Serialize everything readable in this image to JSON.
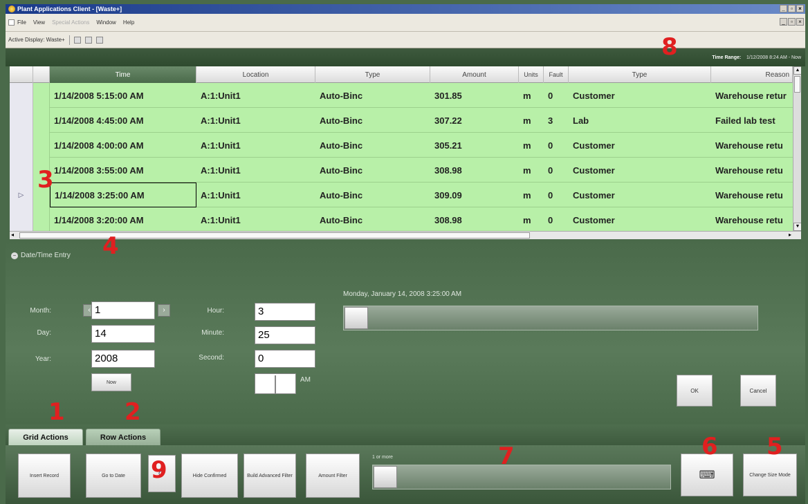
{
  "window": {
    "title": "Plant Applications Client - [Waste+]"
  },
  "menu": {
    "items": [
      "File",
      "View",
      "Special Actions",
      "Window",
      "Help"
    ]
  },
  "toolbar": {
    "active_display": "Active Display: Waste+"
  },
  "header": {
    "time_range_label": "Time Range:",
    "time_range_value": "1/12/2008 8:24 AM - Now"
  },
  "grid": {
    "columns": [
      "Time",
      "Location",
      "Type",
      "Amount",
      "Units",
      "Fault",
      "Type",
      "Reason"
    ],
    "rows": [
      {
        "time": "1/14/2008 5:15:00 AM",
        "location": "A:1:Unit1",
        "type": "Auto-Binc",
        "amount": "301.85",
        "units": "m",
        "fault": "0",
        "type2": "Customer",
        "reason": "Warehouse retur"
      },
      {
        "time": "1/14/2008 4:45:00 AM",
        "location": "A:1:Unit1",
        "type": "Auto-Binc",
        "amount": "307.22",
        "units": "m",
        "fault": "3",
        "type2": "Lab",
        "reason": "Failed lab test"
      },
      {
        "time": "1/14/2008 4:00:00 AM",
        "location": "A:1:Unit1",
        "type": "Auto-Binc",
        "amount": "305.21",
        "units": "m",
        "fault": "0",
        "type2": "Customer",
        "reason": "Warehouse retu"
      },
      {
        "time": "1/14/2008 3:55:00 AM",
        "location": "A:1:Unit1",
        "type": "Auto-Binc",
        "amount": "308.98",
        "units": "m",
        "fault": "0",
        "type2": "Customer",
        "reason": "Warehouse retu"
      },
      {
        "time": "1/14/2008 3:25:00 AM",
        "location": "A:1:Unit1",
        "type": "Auto-Binc",
        "amount": "309.09",
        "units": "m",
        "fault": "0",
        "type2": "Customer",
        "reason": "Warehouse retu"
      },
      {
        "time": "1/14/2008 3:20:00 AM",
        "location": "A:1:Unit1",
        "type": "Auto-Binc",
        "amount": "308.98",
        "units": "m",
        "fault": "0",
        "type2": "Customer",
        "reason": "Warehouse retu"
      }
    ]
  },
  "datetime": {
    "section_title": "Date/Time Entry",
    "month_label": "Month:",
    "month_value": "1",
    "day_label": "Day:",
    "day_value": "14",
    "year_label": "Year:",
    "year_value": "2008",
    "hour_label": "Hour:",
    "hour_value": "3",
    "minute_label": "Minute:",
    "minute_value": "25",
    "second_label": "Second:",
    "second_value": "0",
    "ampm_value": "AM",
    "now_button": "Now",
    "display_date": "Monday, January 14, 2008 3:25:00 AM",
    "ok_button": "OK",
    "cancel_button": "Cancel"
  },
  "tabs": [
    "Grid Actions",
    "Row Actions"
  ],
  "actions": {
    "insert_record": "Insert Record",
    "go_to_date": "Go to Date",
    "hide_confirmed": "Hide Confirmed",
    "build_filter": "Build Advanced Filter",
    "amount_filter": "Amount Filter",
    "slider_label": "1 or more",
    "change_size": "Change Size Mode"
  },
  "annotations": [
    "1",
    "2",
    "3",
    "4",
    "5",
    "6",
    "7",
    "8",
    "9"
  ]
}
